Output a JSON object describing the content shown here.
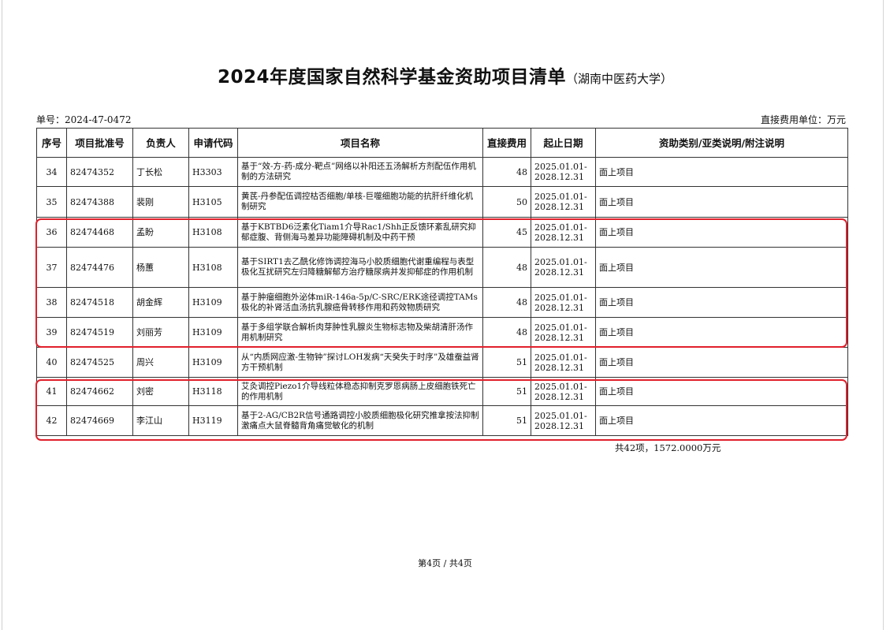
{
  "title": "2024年度国家自然科学基金资助项目清单",
  "subtitle": "（湖南中医药大学）",
  "doc_number": "单号：2024-47-0472",
  "unit_note": "直接费用单位：万元",
  "headers": [
    "序号",
    "项目批准号",
    "负责人",
    "申请代码",
    "项目名称",
    "直接费用",
    "起止日期",
    "资助类别/亚类说明/附注说明"
  ],
  "rows": [
    {
      "no": "34",
      "approval": "82474352",
      "leader": "丁长松",
      "code": "H3303",
      "name": "基于“效-方-药-成分-靶点”网络以补阳还五汤解析方剂配伍作用机制的方法研究",
      "fee": "48",
      "start": "2025.01.01-",
      "end": "2028.12.31",
      "category": "面上项目"
    },
    {
      "no": "35",
      "approval": "82474388",
      "leader": "裴刚",
      "code": "H3105",
      "name": "黄芪-丹参配伍调控枯否细胞/单核-巨噬细胞功能的抗肝纤维化机制研究",
      "fee": "50",
      "start": "2025.01.01-",
      "end": "2028.12.31",
      "category": "面上项目"
    },
    {
      "no": "36",
      "approval": "82474468",
      "leader": "孟盼",
      "code": "H3108",
      "name": "基于KBTBD6泛素化Tiam1介导Rac1/Shh正反馈环紊乱研究抑郁症腹、背侧海马差异功能障碍机制及中药干预",
      "fee": "45",
      "start": "2025.01.01-",
      "end": "2028.12.31",
      "category": "面上项目"
    },
    {
      "no": "37",
      "approval": "82474476",
      "leader": "杨蕙",
      "code": "H3108",
      "name": "基于SIRT1去乙酰化修饰调控海马小胶质细胞代谢重编程与表型极化互扰研究左归降糖解郁方治疗糖尿病并发抑郁症的作用机制",
      "fee": "48",
      "start": "2025.01.01-",
      "end": "2028.12.31",
      "category": "面上项目"
    },
    {
      "no": "38",
      "approval": "82474518",
      "leader": "胡金辉",
      "code": "H3109",
      "name": "基于肿瘤细胞外泌体miR-146a-5p/C-SRC/ERK途径调控TAMs极化的补肾活血汤抗乳腺癌骨转移作用和药效物质研究",
      "fee": "48",
      "start": "2025.01.01-",
      "end": "2028.12.31",
      "category": "面上项目"
    },
    {
      "no": "39",
      "approval": "82474519",
      "leader": "刘丽芳",
      "code": "H3109",
      "name": "基于多组学联合解析肉芽肿性乳腺炎生物标志物及柴胡清肝汤作用机制研究",
      "fee": "48",
      "start": "2025.01.01-",
      "end": "2028.12.31",
      "category": "面上项目"
    },
    {
      "no": "40",
      "approval": "82474525",
      "leader": "周兴",
      "code": "H3109",
      "name": "从“内质网应激-生物钟”探讨LOH发病“天癸失于时序”及雄蚕益肾方干预机制",
      "fee": "51",
      "start": "2025.01.01-",
      "end": "2028.12.31",
      "category": "面上项目"
    },
    {
      "no": "41",
      "approval": "82474662",
      "leader": "刘密",
      "code": "H3118",
      "name": "艾灸调控Piezo1介导线粒体稳态抑制克罗恩病肠上皮细胞铁死亡的作用机制",
      "fee": "51",
      "start": "2025.01.01-",
      "end": "2028.12.31",
      "category": "面上项目"
    },
    {
      "no": "42",
      "approval": "82474669",
      "leader": "李江山",
      "code": "H3119",
      "name": "基于2-AG/CB2R信号通路调控小胶质细胞极化研究推拿按法抑制激痛点大鼠脊髓背角痛觉敏化的机制",
      "fee": "51",
      "start": "2025.01.01-",
      "end": "2028.12.31",
      "category": "面上项目"
    }
  ],
  "total": "共42项，1572.0000万元",
  "footer": "第4页 / 共4页",
  "colors": {
    "highlight": "#e0202c",
    "border": "#333333"
  }
}
